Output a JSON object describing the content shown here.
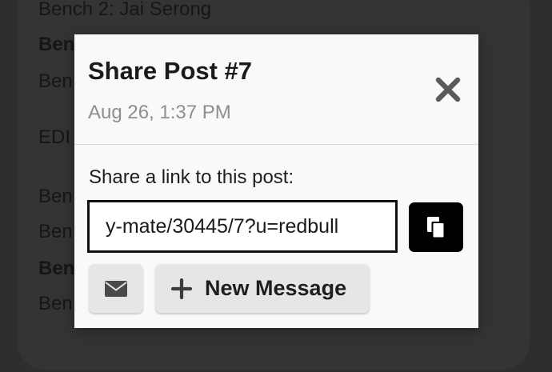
{
  "background": {
    "lines": [
      {
        "text": "Bench 2: Jai Serong",
        "bold": false
      },
      {
        "text": "Ben",
        "bold": true
      },
      {
        "text": "Ben",
        "bold": false
      },
      {
        "text": "EDI",
        "bold": false
      },
      {
        "text": "Ben",
        "bold": false
      },
      {
        "text": "Ben",
        "bold": false
      },
      {
        "text": "Ben",
        "bold": true
      },
      {
        "text": "Ben",
        "bold": false
      }
    ]
  },
  "modal": {
    "title": "Share Post #7",
    "date": "Aug 26, 1:37 PM",
    "share_label": "Share a link to this post:",
    "link_value": "y-mate/30445/7?u=redbull",
    "new_message_label": "New Message"
  },
  "icons": {
    "close": "close-icon",
    "copy": "copy-icon",
    "email": "envelope-icon",
    "plus": "plus-icon"
  },
  "colors": {
    "overlay": "#2c2c2c",
    "modal_bg": "#f9f9f9",
    "copy_button": "#000000",
    "secondary_button": "#e6e6e6",
    "date_text": "#8e8e8e"
  }
}
